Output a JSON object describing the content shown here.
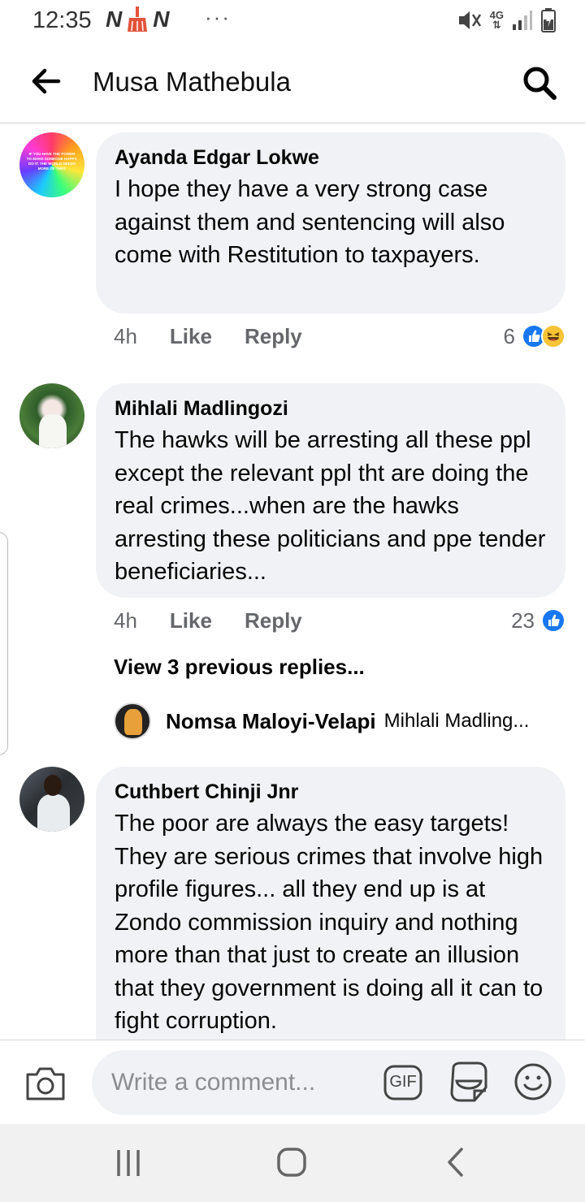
{
  "status_bar": {
    "time": "12:35",
    "left_icons": [
      "n-notification-icon",
      "broom-icon",
      "n-notification-icon"
    ],
    "more": "···",
    "network": "4G"
  },
  "header": {
    "title": "Musa Mathebula"
  },
  "comments": [
    {
      "author": "Ayanda Edgar Lokwe",
      "avatar_text": "IF YOU HAVE THE POWER TO MAKE SOMEONE HAPPY, DO IT. THE WORLD NEEDS MORE OF THAT.",
      "text": "I hope they have a very strong case against them and sentencing will also come with Restitution to taxpayers.",
      "time": "4h",
      "like_label": "Like",
      "reply_label": "Reply",
      "reaction_count": "6",
      "reactions": [
        "like",
        "haha"
      ]
    },
    {
      "author": "Mihlali Madlingozi",
      "text": "The hawks will be arresting all these ppl except the relevant ppl tht are doing the real crimes...when are the hawks arresting these politicians and ppe tender beneficiaries...",
      "time": "4h",
      "like_label": "Like",
      "reply_label": "Reply",
      "reaction_count": "23",
      "reactions": [
        "like"
      ],
      "view_replies": "View 3 previous replies...",
      "latest_reply": {
        "author": "Nomsa Maloyi-Velapi",
        "preview": "Mihlali Madling..."
      }
    },
    {
      "author": "Cuthbert Chinji Jnr",
      "text": "The poor are always the easy targets! They are serious crimes that involve high profile figures... all they end up is at Zondo commission inquiry and nothing more than that just to create an illusion that they government is doing all it can to fight corruption."
    }
  ],
  "composer": {
    "placeholder": "Write a comment...",
    "gif_label": "GIF"
  },
  "colors": {
    "like_blue": "#1877f2",
    "bubble_bg": "#f0f2f5",
    "meta_gray": "#65676b"
  }
}
